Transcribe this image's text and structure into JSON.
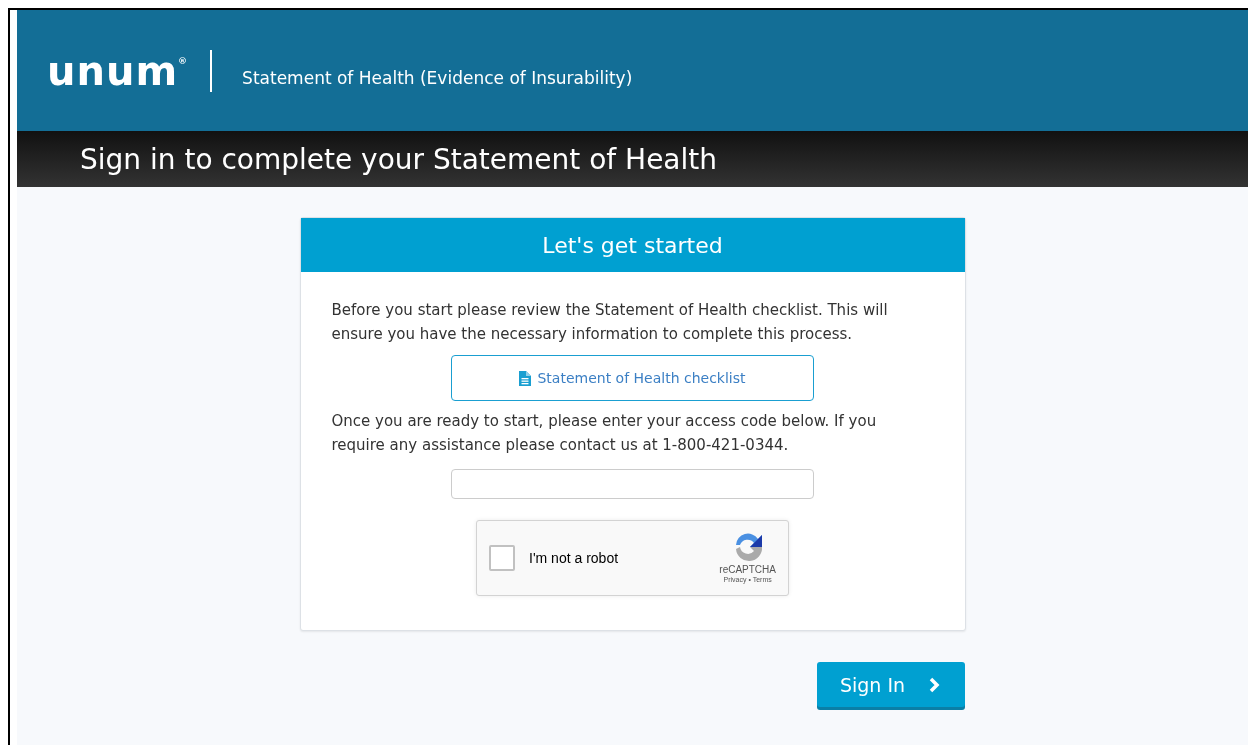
{
  "header": {
    "logo": "unum",
    "registered_mark": "®",
    "title": "Statement of Health (Evidence of Insurability)"
  },
  "banner": {
    "title": "Sign in to complete your Statement of Health"
  },
  "card": {
    "title": "Let's get started",
    "intro": "Before you start please review the Statement of Health checklist. This will ensure you have the necessary information to complete this process.",
    "checklist_button": "Statement of Health checklist",
    "instructions": "Once you are ready to start, please enter your access code below. If you require any assistance please contact us at 1-800-421-0344.",
    "captcha": {
      "label": "I'm not a robot",
      "checked": false,
      "brand": "reCAPTCHA",
      "links": "Privacy • Terms"
    }
  },
  "sign_in_button": "Sign In"
}
